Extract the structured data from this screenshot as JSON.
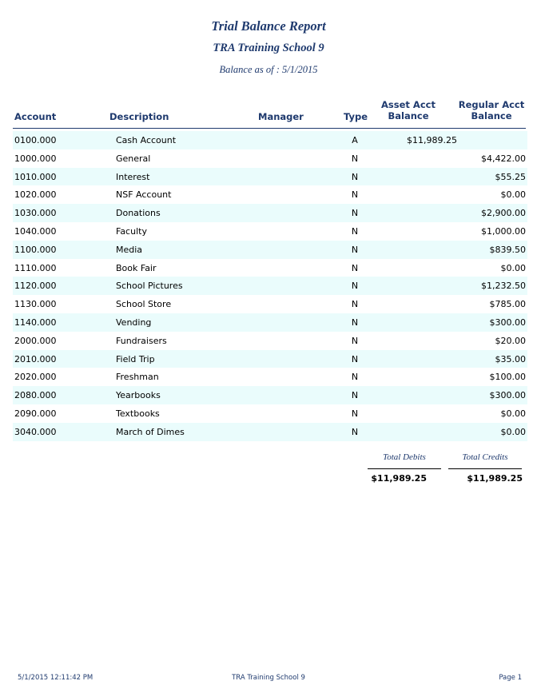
{
  "report": {
    "title": "Trial Balance Report",
    "school": "TRA Training School 9",
    "as_of": "Balance as of :  5/1/2015"
  },
  "headers": {
    "account": "Account",
    "description": "Description",
    "manager": "Manager",
    "type": "Type",
    "asset_line1": "Asset Acct",
    "asset_line2": "Balance",
    "regular_line1": "Regular Acct",
    "regular_line2": "Balance"
  },
  "rows": [
    {
      "account": "0100.000",
      "description": "Cash Account",
      "manager": "",
      "type": "A",
      "asset": "$11,989.25",
      "regular": ""
    },
    {
      "account": "1000.000",
      "description": "General",
      "manager": "",
      "type": "N",
      "asset": "",
      "regular": "$4,422.00"
    },
    {
      "account": "1010.000",
      "description": "Interest",
      "manager": "",
      "type": "N",
      "asset": "",
      "regular": "$55.25"
    },
    {
      "account": "1020.000",
      "description": "NSF Account",
      "manager": "",
      "type": "N",
      "asset": "",
      "regular": "$0.00"
    },
    {
      "account": "1030.000",
      "description": "Donations",
      "manager": "",
      "type": "N",
      "asset": "",
      "regular": "$2,900.00"
    },
    {
      "account": "1040.000",
      "description": "Faculty",
      "manager": "",
      "type": "N",
      "asset": "",
      "regular": "$1,000.00"
    },
    {
      "account": "1100.000",
      "description": "Media",
      "manager": "",
      "type": "N",
      "asset": "",
      "regular": "$839.50"
    },
    {
      "account": "1110.000",
      "description": "Book Fair",
      "manager": "",
      "type": "N",
      "asset": "",
      "regular": "$0.00"
    },
    {
      "account": "1120.000",
      "description": "School Pictures",
      "manager": "",
      "type": "N",
      "asset": "",
      "regular": "$1,232.50"
    },
    {
      "account": "1130.000",
      "description": "School Store",
      "manager": "",
      "type": "N",
      "asset": "",
      "regular": "$785.00"
    },
    {
      "account": "1140.000",
      "description": "Vending",
      "manager": "",
      "type": "N",
      "asset": "",
      "regular": "$300.00"
    },
    {
      "account": "2000.000",
      "description": "Fundraisers",
      "manager": "",
      "type": "N",
      "asset": "",
      "regular": "$20.00"
    },
    {
      "account": "2010.000",
      "description": "Field Trip",
      "manager": "",
      "type": "N",
      "asset": "",
      "regular": "$35.00"
    },
    {
      "account": "2020.000",
      "description": "Freshman",
      "manager": "",
      "type": "N",
      "asset": "",
      "regular": "$100.00"
    },
    {
      "account": "2080.000",
      "description": "Yearbooks",
      "manager": "",
      "type": "N",
      "asset": "",
      "regular": "$300.00"
    },
    {
      "account": "2090.000",
      "description": "Textbooks",
      "manager": "",
      "type": "N",
      "asset": "",
      "regular": "$0.00"
    },
    {
      "account": "3040.000",
      "description": "March of Dimes",
      "manager": "",
      "type": "N",
      "asset": "",
      "regular": "$0.00"
    }
  ],
  "totals": {
    "debits_label": "Total Debits",
    "credits_label": "Total Credits",
    "debits_value": "$11,989.25",
    "credits_value": "$11,989.25"
  },
  "footer": {
    "printed": "5/1/2015 12:11:42 PM",
    "school": "TRA Training School 9",
    "page": "Page 1"
  },
  "colors": {
    "heading": "#1f3a6e",
    "row_stripe": "#eafcfc"
  }
}
